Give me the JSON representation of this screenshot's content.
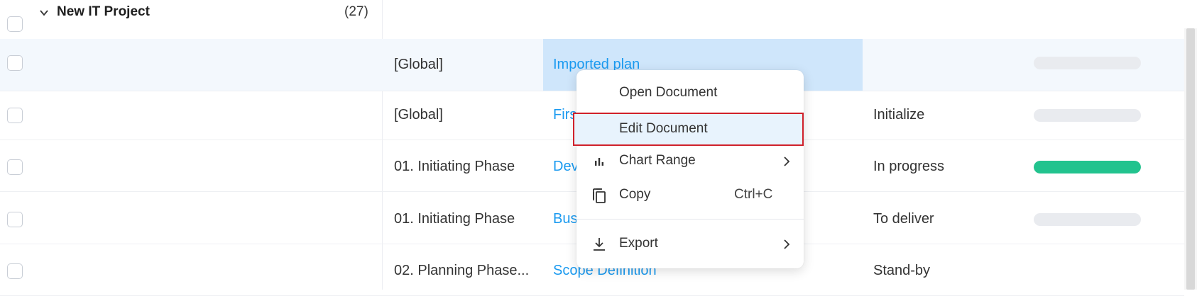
{
  "group": {
    "title": "New IT Project",
    "count": "(27)"
  },
  "rows": [
    {
      "phase": "[Global]",
      "document": "Imported plan",
      "status": "",
      "progress": 0
    },
    {
      "phase": "[Global]",
      "document": "Firs",
      "status": "Initialize",
      "progress": 0
    },
    {
      "phase": "01. Initiating Phase",
      "document": "Dev",
      "status": "In progress",
      "progress": 1.0
    },
    {
      "phase": "01. Initiating Phase",
      "document": "Bus",
      "status": "To deliver",
      "progress": 0
    },
    {
      "phase": "02. Planning Phase...",
      "document": "Scope Definition",
      "status": "Stand-by",
      "progress": 0
    }
  ],
  "context_menu": {
    "open": "Open Document",
    "edit": "Edit Document",
    "chart_range": "Chart Range",
    "copy": "Copy",
    "copy_shortcut": "Ctrl+C",
    "export": "Export"
  },
  "colors": {
    "link": "#1a9af0",
    "progress_fill": "#22c38e",
    "highlight_border": "#d0202a",
    "selected_cell": "#cfe6fb"
  },
  "icons": {
    "group_toggle": "chevron-down-icon",
    "chart_range": "bar-chart-icon",
    "copy": "copy-icon",
    "export": "download-icon",
    "submenu": "chevron-right-icon"
  }
}
